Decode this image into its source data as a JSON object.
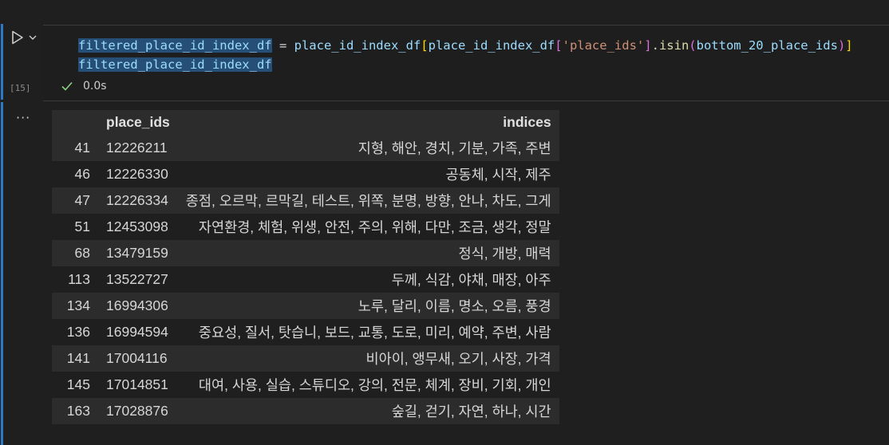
{
  "cell": {
    "execution_count": "[15]",
    "code_line1": {
      "var1": "filtered_place_id_index_df",
      "eq": " = ",
      "obj": "place_id_index_df",
      "br_open": "[",
      "obj2": "place_id_index_df",
      "br2_open": "[",
      "key": "'place_ids'",
      "br2_close": "]",
      "dot": ".",
      "method": "isin",
      "paren_open": "(",
      "arg": "bottom_20_place_ids",
      "paren_close": ")",
      "br_close": "]"
    },
    "code_line2": "filtered_place_id_index_df",
    "status_time": "0.0s",
    "output_menu": "···"
  },
  "table": {
    "columns": [
      "place_ids",
      "indices"
    ],
    "rows": [
      {
        "index": "41",
        "place_id": "12226211",
        "indices": "지형, 해안, 경치, 기분, 가족, 주변"
      },
      {
        "index": "46",
        "place_id": "12226330",
        "indices": "공동체, 시작, 제주"
      },
      {
        "index": "47",
        "place_id": "12226334",
        "indices": "종점, 오르막, 르막길, 테스트, 위쪽, 분명, 방향, 안나, 차도, 그게"
      },
      {
        "index": "51",
        "place_id": "12453098",
        "indices": "자연환경, 체험, 위생, 안전, 주의, 위해, 다만, 조금, 생각, 정말"
      },
      {
        "index": "68",
        "place_id": "13479159",
        "indices": "정식, 개방, 매력"
      },
      {
        "index": "113",
        "place_id": "13522727",
        "indices": "두께, 식감, 야채, 매장, 아주"
      },
      {
        "index": "134",
        "place_id": "16994306",
        "indices": "노루, 달리, 이름, 명소, 오름, 풍경"
      },
      {
        "index": "136",
        "place_id": "16994594",
        "indices": "중요성, 질서, 탓습니, 보드, 교통, 도로, 미리, 예약, 주변, 사람"
      },
      {
        "index": "141",
        "place_id": "17004116",
        "indices": "비아이, 앵무새, 오기, 사장, 가격"
      },
      {
        "index": "145",
        "place_id": "17014851",
        "indices": "대여, 사용, 실습, 스튜디오, 강의, 전문, 체계, 장비, 기회, 개인"
      },
      {
        "index": "163",
        "place_id": "17028876",
        "indices": "숲길, 걷기, 자연, 하나, 시간"
      }
    ]
  },
  "colors": {
    "background": "#1f1f1f",
    "accent_bar": "#2b79c7",
    "check": "#89d185",
    "selection": "#264f78"
  },
  "icons": {
    "run": "play-icon",
    "run_menu": "chevron-down-icon",
    "status": "check-icon"
  }
}
